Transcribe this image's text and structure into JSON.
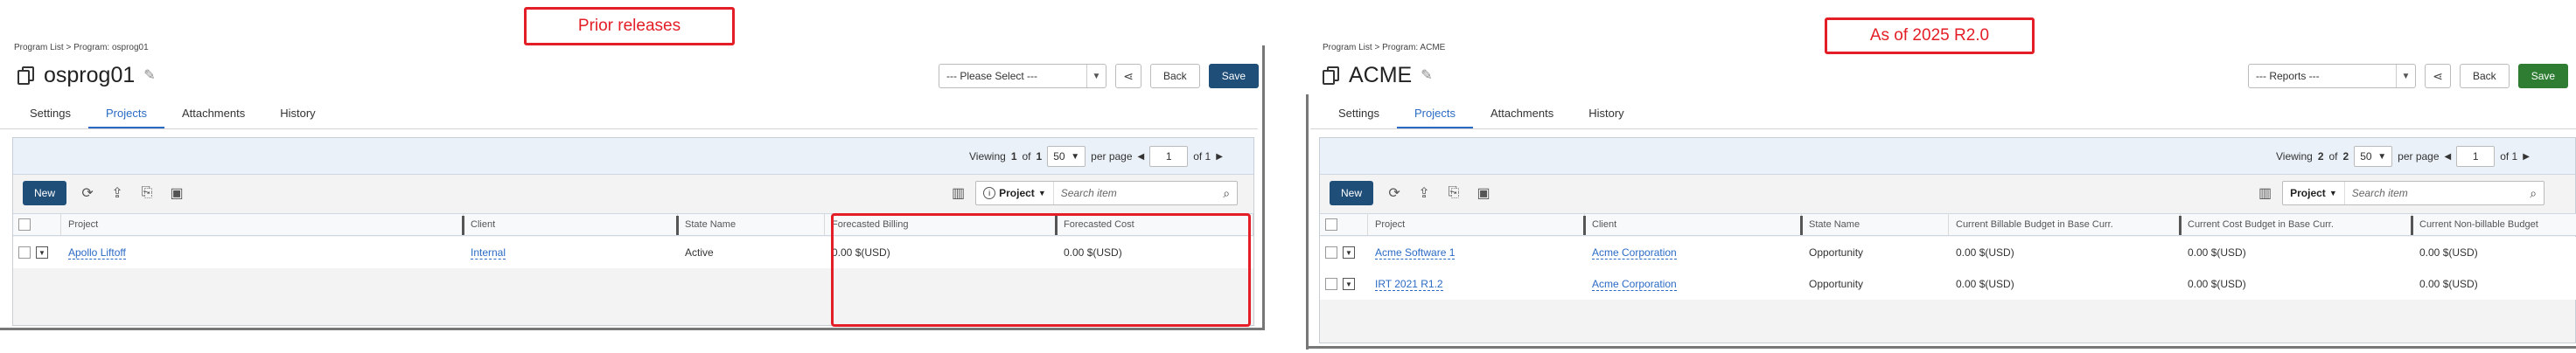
{
  "annotations": {
    "left_label": "Prior releases",
    "right_label": "As of 2025 R2.0"
  },
  "colors": {
    "annotation_red": "#e41e26",
    "save_left": "#1f4e79",
    "save_right": "#2e7d32",
    "link_blue": "#2a6ac4",
    "new_button": "#1f4e79"
  },
  "left": {
    "breadcrumb": "Program List > Program: osprog01",
    "title": "osprog01",
    "select_placeholder": "--- Please Select ---",
    "back_label": "Back",
    "save_label": "Save",
    "tabs": [
      "Settings",
      "Projects",
      "Attachments",
      "History"
    ],
    "active_tab": "Projects",
    "pager": {
      "viewing_label": "Viewing",
      "current": "1",
      "of_label": "of",
      "total": "1",
      "per_page_value": "50",
      "per_page_label": "per page",
      "page_input": "1",
      "page_of": "of 1"
    },
    "new_label": "New",
    "search_field": "Project",
    "search_placeholder": "Search item",
    "columns": [
      "Project",
      "Client",
      "State Name",
      "Forecasted Billing",
      "Forecasted Cost"
    ],
    "rows": [
      {
        "project": "Apollo Liftoff",
        "client": "Internal",
        "state": "Active",
        "billing": "0.00 $(USD)",
        "cost": "0.00 $(USD)"
      }
    ]
  },
  "right": {
    "breadcrumb": "Program List > Program: ACME",
    "title": "ACME",
    "select_placeholder": "--- Reports ---",
    "back_label": "Back",
    "save_label": "Save",
    "tabs": [
      "Settings",
      "Projects",
      "Attachments",
      "History"
    ],
    "active_tab": "Projects",
    "pager": {
      "viewing_label": "Viewing",
      "current": "2",
      "of_label": "of",
      "total": "2",
      "per_page_value": "50",
      "per_page_label": "per page",
      "page_input": "1",
      "page_of": "of 1"
    },
    "new_label": "New",
    "search_field": "Project",
    "search_placeholder": "Search item",
    "columns": [
      "Project",
      "Client",
      "State Name",
      "Current Billable Budget in Base Curr.",
      "Current Cost Budget in Base Curr.",
      "Current Non-billable Budget"
    ],
    "rows": [
      {
        "project": "Acme Software 1",
        "client": "Acme Corporation",
        "state": "Opportunity",
        "c1": "0.00 $(USD)",
        "c2": "0.00 $(USD)",
        "c3": "0.00 $(USD)"
      },
      {
        "project": "IRT 2021 R1.2",
        "client": "Acme Corporation",
        "state": "Opportunity",
        "c1": "0.00 $(USD)",
        "c2": "0.00 $(USD)",
        "c3": "0.00 $(USD)"
      }
    ]
  },
  "icons": [
    "edit-pencil-icon",
    "share-icon",
    "refresh-icon",
    "export-icon",
    "copy-icon",
    "duplicate-icon",
    "columns-icon",
    "info-icon",
    "search-icon",
    "chevron-down-icon"
  ]
}
